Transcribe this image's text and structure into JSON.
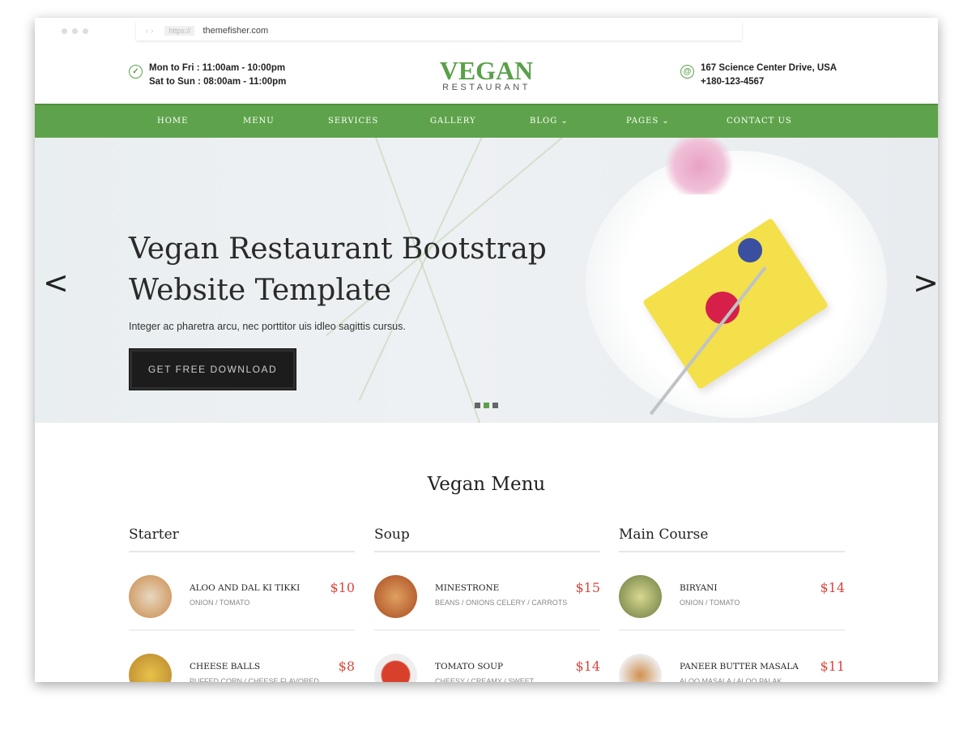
{
  "browser": {
    "proto": "https://",
    "url": "themefisher.com"
  },
  "header": {
    "hours": [
      "Mon to Fri : 11:00am - 10:00pm",
      "Sat to Sun : 08:00am - 11:00pm"
    ],
    "logo": {
      "main": "VEGAN",
      "sub": "RESTAURANT"
    },
    "contact": [
      "167 Science Center Drive, USA",
      "+180-123-4567"
    ]
  },
  "nav": [
    {
      "label": "HOME"
    },
    {
      "label": "MENU"
    },
    {
      "label": "SERVICES"
    },
    {
      "label": "GALLERY"
    },
    {
      "label": "BLOG ⌄"
    },
    {
      "label": "PAGES ⌄"
    },
    {
      "label": "CONTACT US"
    }
  ],
  "hero": {
    "title_l1": "Vegan Restaurant Bootstrap",
    "title_l2": "Website Template",
    "subtitle": "Integer ac pharetra arcu, nec porttitor uis idleo sagittis cursus.",
    "button": "GET FREE DOWNLOAD",
    "active_slide": 2,
    "slides": 3
  },
  "menu": {
    "title": "Vegan Menu",
    "columns": [
      {
        "title": "Starter",
        "items": [
          {
            "name": "ALOO AND DAL KI TIKKI",
            "desc": "ONION / TOMATO",
            "price": "$10"
          },
          {
            "name": "CHEESE BALLS",
            "desc": "PUFFED CORN / CHEESE FLAVORED",
            "price": "$8"
          }
        ]
      },
      {
        "title": "Soup",
        "items": [
          {
            "name": "MINESTRONE",
            "desc": "BEANS / ONIONS CELERY / CARROTS",
            "price": "$15"
          },
          {
            "name": "TOMATO SOUP",
            "desc": "CHEESY / CREAMY / SWEET",
            "price": "$14"
          }
        ]
      },
      {
        "title": "Main Course",
        "items": [
          {
            "name": "BIRYANI",
            "desc": "ONION / TOMATO",
            "price": "$14"
          },
          {
            "name": "PANEER BUTTER MASALA",
            "desc": "ALOO MASALA / ALOO PALAK",
            "price": "$11"
          }
        ]
      }
    ]
  },
  "colors": {
    "brand": "#5ea34b",
    "price": "#d9473c"
  }
}
